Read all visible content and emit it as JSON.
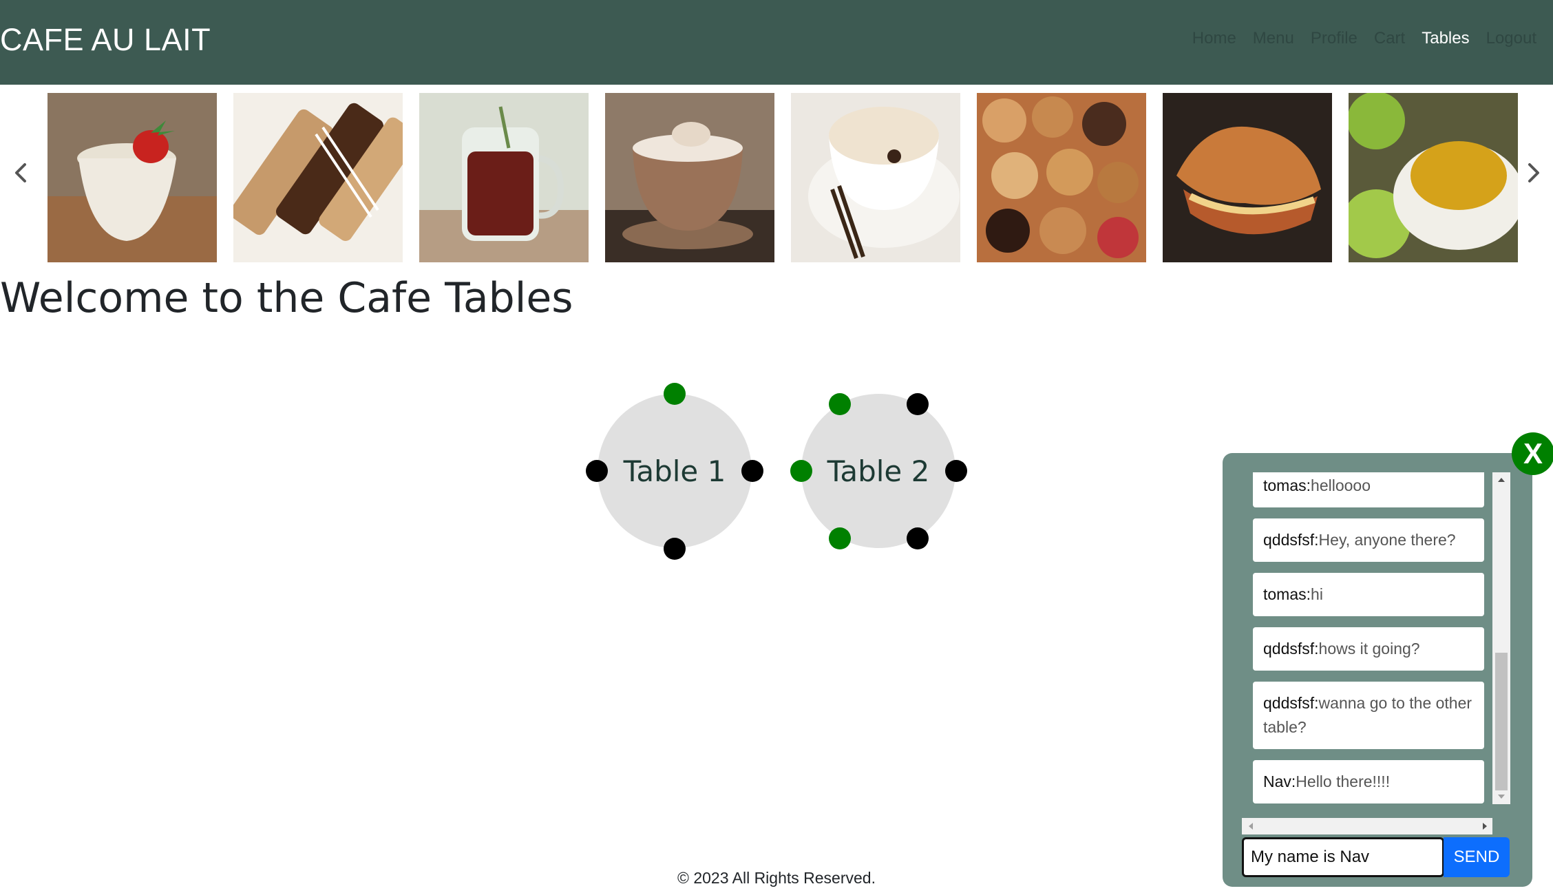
{
  "header": {
    "brand": "CAFE AU LAIT",
    "nav": [
      {
        "label": "Home",
        "active": false
      },
      {
        "label": "Menu",
        "active": false
      },
      {
        "label": "Profile",
        "active": false
      },
      {
        "label": "Cart",
        "active": false
      },
      {
        "label": "Tables",
        "active": true
      },
      {
        "label": "Logout",
        "active": false
      }
    ]
  },
  "carousel": {
    "prev_icon": "chevron-left-icon",
    "next_icon": "chevron-right-icon",
    "slides": [
      {
        "subject": "strawberry-milkshake"
      },
      {
        "subject": "chocolate-biscotti"
      },
      {
        "subject": "iced-tea-jar"
      },
      {
        "subject": "mocha-latte"
      },
      {
        "subject": "chai-latte"
      },
      {
        "subject": "cookies"
      },
      {
        "subject": "croissant-sandwich"
      },
      {
        "subject": "green-tea-cup"
      }
    ]
  },
  "page": {
    "title": "Welcome to the Cafe Tables"
  },
  "tables": [
    {
      "label": "Table 1",
      "seats": [
        "free",
        "taken",
        "taken",
        "taken"
      ]
    },
    {
      "label": "Table 2",
      "seats": [
        "free",
        "taken",
        "free",
        "taken",
        "free",
        "taken"
      ]
    }
  ],
  "colors": {
    "header_bg": "#3d5a52",
    "seat_free": "#008000",
    "seat_taken": "#000000",
    "chat_bg": "#6f8e86",
    "send_bg": "#0d6efd"
  },
  "chat": {
    "close_label": "X",
    "messages": [
      {
        "user": "tomas:",
        "text": "helloooo"
      },
      {
        "user": "qddsfsf:",
        "text": "Hey, anyone there?"
      },
      {
        "user": "tomas:",
        "text": "hi"
      },
      {
        "user": "qddsfsf:",
        "text": "hows it going?"
      },
      {
        "user": "qddsfsf:",
        "text": "wanna go to the other table?"
      },
      {
        "user": "Nav:",
        "text": "Hello there!!!!"
      }
    ],
    "input_value": "My name is Nav",
    "send_label": "SEND"
  },
  "footer": {
    "text": "© 2023 All Rights Reserved."
  }
}
